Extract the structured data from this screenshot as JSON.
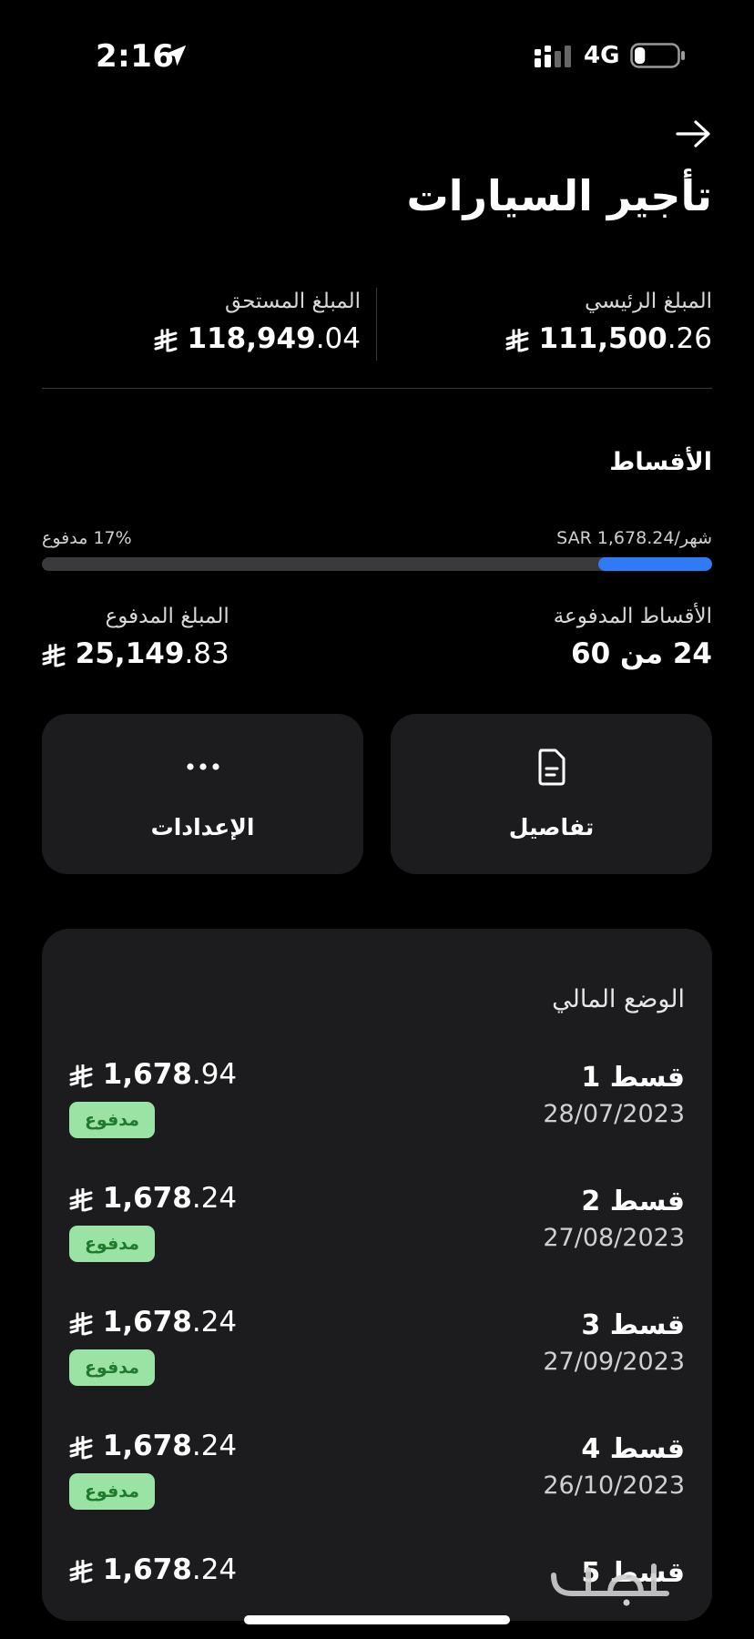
{
  "status_bar": {
    "time": "2:16",
    "network": "4G",
    "battery_level": 0.25
  },
  "header": {
    "title": "تأجير السيارات"
  },
  "summary": {
    "principal": {
      "label": "المبلغ الرئيسي",
      "int": "111,500",
      "dec": ".26"
    },
    "due": {
      "label": "المبلغ المستحق",
      "int": "118,949",
      "dec": ".04"
    }
  },
  "installments": {
    "title": "الأقساط",
    "monthly": "SAR 1,678.24/شهر",
    "paid_percent_label": "17% مدفوع",
    "progress": 0.17,
    "paid_count": {
      "label": "الأقساط المدفوعة",
      "value": "24 من 60"
    },
    "paid_amount": {
      "label": "المبلغ المدفوع",
      "int": "25,149",
      "dec": ".83"
    }
  },
  "actions": {
    "details": {
      "label": "تفاصيل",
      "icon": "document-icon"
    },
    "settings": {
      "label": "الإعدادات",
      "icon": "more-icon"
    }
  },
  "financial_status": {
    "title": "الوضع المالي",
    "items": [
      {
        "name": "قسط 1",
        "date": "28/07/2023",
        "int": "1,678",
        "dec": ".94",
        "status": "مدفوع"
      },
      {
        "name": "قسط 2",
        "date": "27/08/2023",
        "int": "1,678",
        "dec": ".24",
        "status": "مدفوع"
      },
      {
        "name": "قسط 3",
        "date": "27/09/2023",
        "int": "1,678",
        "dec": ".24",
        "status": "مدفوع"
      },
      {
        "name": "قسط 4",
        "date": "26/10/2023",
        "int": "1,678",
        "dec": ".24",
        "status": "مدفوع"
      },
      {
        "name": "قسط 5",
        "date": "",
        "int": "1,678",
        "dec": ".24",
        "status": ""
      }
    ]
  },
  "colors": {
    "accent": "#2f7bf5",
    "card": "#1c1c1e",
    "badge_bg": "#9be3a5",
    "badge_text": "#1f7a2e"
  }
}
